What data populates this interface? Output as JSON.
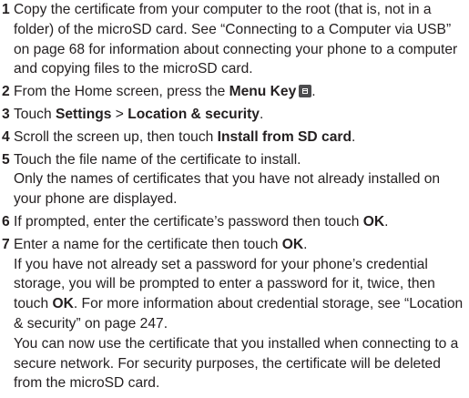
{
  "steps": [
    {
      "number": "1",
      "text": "Copy the certificate from your computer to the root (that is, not in a folder) of the microSD card. See “Connecting to a Computer via USB” on page 68 for information about connecting your phone to a computer and copying files to the microSD card."
    },
    {
      "number": "2",
      "pre": "From the Home screen, press the ",
      "bold": "Menu Key",
      "post": ".",
      "icon": "menu-key-icon"
    },
    {
      "number": "3",
      "pre": "Touch ",
      "bold1": "Settings",
      "mid": " > ",
      "bold2": "Location & security",
      "post": "."
    },
    {
      "number": "4",
      "pre": "Scroll the screen up, then touch ",
      "bold": "Install from SD card",
      "post": "."
    },
    {
      "number": "5",
      "text": "Touch the file name of the certificate to install.",
      "sub": "Only the names of certificates that you have not already installed on your phone are displayed."
    },
    {
      "number": "6",
      "pre": "If prompted, enter the certificate’s password then touch ",
      "bold": "OK",
      "post": "."
    },
    {
      "number": "7",
      "pre": "Enter a name for the certificate then touch ",
      "bold": "OK",
      "post": ".",
      "sub1_pre": "If you have not already set a password for your phone’s credential storage, you will be prompted to enter a password for it, twice, then touch ",
      "sub1_bold": "OK",
      "sub1_post": ". For more information about credential storage, see “Location & security” on page 247.",
      "sub2": "You can now use the certificate that you installed when connecting to a secure network. For security purposes, the certificate will be deleted from the microSD card."
    }
  ]
}
